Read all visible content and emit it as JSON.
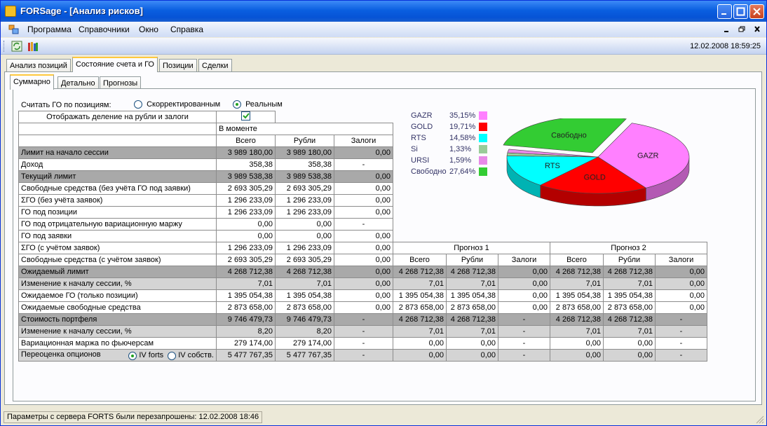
{
  "window": {
    "title": "FORSage - [Анализ рисков]"
  },
  "menu": [
    "Программа",
    "Справочники",
    "Окно",
    "Справка"
  ],
  "toolbar": {
    "clock": "12.02.2008 18:59:25"
  },
  "tabs": [
    "Анализ позиций",
    "Состояние счета и ГО",
    "Позиции",
    "Сделки"
  ],
  "subtabs": [
    "Суммарно",
    "Детально",
    "Прогнозы"
  ],
  "options": {
    "calc_label": "Считать ГО по позициям:",
    "radio_corrected": "Скорректированным",
    "radio_real": "Реальным",
    "split_label": "Отображать деление на рубли и залоги",
    "split_checked": true
  },
  "headers": {
    "moment": "В моменте",
    "forecast1": "Прогноз 1",
    "forecast2": "Прогноз 2",
    "sub": [
      "Всего",
      "Рубли",
      "Залоги"
    ]
  },
  "rows": [
    {
      "label": "Лимит на начало сессии",
      "m": [
        "3 989 180,00",
        "3 989 180,00",
        "0,00"
      ]
    },
    {
      "label": "Доход",
      "m": [
        "358,38",
        "358,38",
        "-"
      ]
    },
    {
      "label": "Текущий лимит",
      "m": [
        "3 989 538,38",
        "3 989 538,38",
        "0,00"
      ]
    },
    {
      "label": "Свободные средства (без учёта ГО под заявки)",
      "m": [
        "2 693 305,29",
        "2 693 305,29",
        "0,00"
      ]
    },
    {
      "label": "ΣГО (без учёта заявок)",
      "m": [
        "1 296 233,09",
        "1 296 233,09",
        "0,00"
      ]
    },
    {
      "label": "ГО под позиции",
      "m": [
        "1 296 233,09",
        "1 296 233,09",
        "0,00"
      ]
    },
    {
      "label": "ГО под отрицательную вариационную маржу",
      "m": [
        "0,00",
        "0,00",
        "-"
      ]
    },
    {
      "label": "ГО под заявки",
      "m": [
        "0,00",
        "0,00",
        "0,00"
      ]
    },
    {
      "label": "ΣГО (с учётом заявок)",
      "m": [
        "1 296 233,09",
        "1 296 233,09",
        "0,00"
      ]
    },
    {
      "label": "Свободные средства (с учётом заявок)",
      "m": [
        "2 693 305,29",
        "2 693 305,29",
        "0,00"
      ]
    },
    {
      "label": "Ожидаемый лимит",
      "m": [
        "4 268 712,38",
        "4 268 712,38",
        "0,00"
      ],
      "f1": [
        "4 268 712,38",
        "4 268 712,38",
        "0,00"
      ],
      "f2": [
        "4 268 712,38",
        "4 268 712,38",
        "0,00"
      ]
    },
    {
      "label": "Изменение к началу сессии, %",
      "m": [
        "7,01",
        "7,01",
        "0,00"
      ],
      "f1": [
        "7,01",
        "7,01",
        "0,00"
      ],
      "f2": [
        "7,01",
        "7,01",
        "0,00"
      ]
    },
    {
      "label": "Ожидаемое ГО (только позиции)",
      "m": [
        "1 395 054,38",
        "1 395 054,38",
        "0,00"
      ],
      "f1": [
        "1 395 054,38",
        "1 395 054,38",
        "0,00"
      ],
      "f2": [
        "1 395 054,38",
        "1 395 054,38",
        "0,00"
      ]
    },
    {
      "label": "Ожидаемые свободные средства",
      "m": [
        "2 873 658,00",
        "2 873 658,00",
        "0,00"
      ],
      "f1": [
        "2 873 658,00",
        "2 873 658,00",
        "0,00"
      ],
      "f2": [
        "2 873 658,00",
        "2 873 658,00",
        "0,00"
      ]
    },
    {
      "label": "Стоимость портфеля",
      "m": [
        "9 746 479,73",
        "9 746 479,73",
        "-"
      ],
      "f1": [
        "4 268 712,38",
        "4 268 712,38",
        "-"
      ],
      "f2": [
        "4 268 712,38",
        "4 268 712,38",
        "-"
      ]
    },
    {
      "label": "Изменение к началу сессии, %",
      "m": [
        "8,20",
        "8,20",
        "-"
      ],
      "f1": [
        "7,01",
        "7,01",
        "-"
      ],
      "f2": [
        "7,01",
        "7,01",
        "-"
      ]
    },
    {
      "label": "Вариационная маржа по фьючерсам",
      "m": [
        "279 174,00",
        "279 174,00",
        "-"
      ],
      "f1": [
        "0,00",
        "0,00",
        "-"
      ],
      "f2": [
        "0,00",
        "0,00",
        "-"
      ]
    },
    {
      "label": "Переоценка опционов",
      "m": [
        "5 477 767,35",
        "5 477 767,35",
        "-"
      ],
      "f1": [
        "0,00",
        "0,00",
        "-"
      ],
      "f2": [
        "0,00",
        "0,00",
        "-"
      ],
      "radios": [
        "IV forts",
        "IV собств."
      ]
    }
  ],
  "chart_data": {
    "type": "pie",
    "title": "",
    "legend_position": "left",
    "slices": [
      {
        "name": "GAZR",
        "value": 35.15,
        "label": "35,15%",
        "color": "#ff80ff"
      },
      {
        "name": "GOLD",
        "value": 19.71,
        "label": "19,71%",
        "color": "#ff0000"
      },
      {
        "name": "RTS",
        "value": 14.58,
        "label": "14,58%",
        "color": "#00ffff"
      },
      {
        "name": "Si",
        "value": 1.33,
        "label": "1,33%",
        "color": "#99cc99"
      },
      {
        "name": "URSI",
        "value": 1.59,
        "label": "1,59%",
        "color": "#e88ae8"
      },
      {
        "name": "Свободно",
        "value": 27.64,
        "label": "27,64%",
        "color": "#33cc33"
      }
    ]
  },
  "status": {
    "text": "Параметры с сервера FORTS были перезапрошены: 12.02.2008 18:46"
  }
}
